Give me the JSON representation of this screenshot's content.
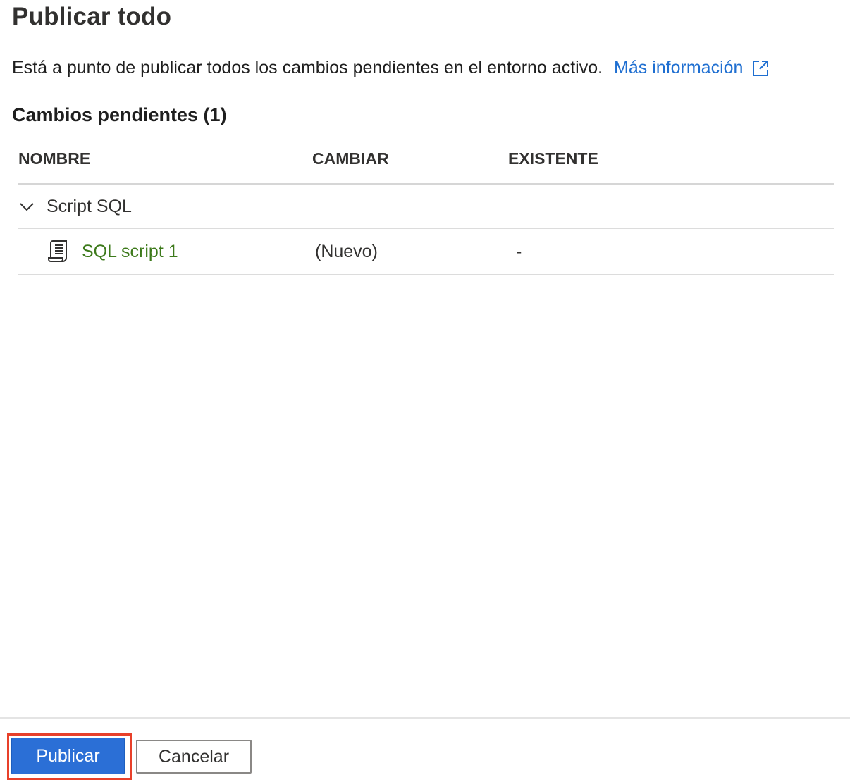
{
  "dialog": {
    "title": "Publicar todo",
    "description": "Está a punto de publicar todos los cambios pendientes en el entorno activo.",
    "learn_more": "Más información",
    "pending_title": "Cambios pendientes (1)"
  },
  "table": {
    "columns": [
      "NOMBRE",
      "CAMBIAR",
      "EXISTENTE"
    ],
    "groups": [
      {
        "label": "Script SQL",
        "icon": "chevron-down-icon",
        "items": [
          {
            "name": "SQL script 1",
            "icon": "script-icon",
            "change": "(Nuevo)",
            "existing": "-"
          }
        ]
      }
    ]
  },
  "footer": {
    "publish_label": "Publicar",
    "cancel_label": "Cancelar"
  },
  "colors": {
    "link": "#1f6fd1",
    "item_link": "#3d7a1b",
    "primary": "#2b6fd6",
    "highlight": "#e8402a"
  }
}
